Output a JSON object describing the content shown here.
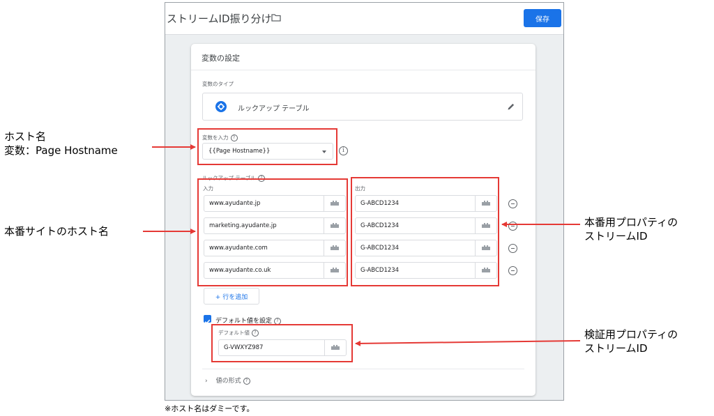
{
  "header": {
    "title": "ストリームID振り分け",
    "save_label": "保存"
  },
  "card": {
    "title": "変数の設定",
    "variable_type_label": "変数のタイプ",
    "variable_type_value": "ルックアップ テーブル",
    "input_variable_label": "変数を入力",
    "input_variable_value": "{{Page Hostname}}",
    "lookup_table_label": "ルックアップ テーブル",
    "input_column_label": "入力",
    "output_column_label": "出力",
    "rows": [
      {
        "input": "www.ayudante.jp",
        "output": "G-ABCD1234"
      },
      {
        "input": "marketing.ayudante.jp",
        "output": "G-ABCD1234"
      },
      {
        "input": "www.ayudante.com",
        "output": "G-ABCD1234"
      },
      {
        "input": "www.ayudante.co.uk",
        "output": "G-ABCD1234"
      }
    ],
    "add_row_label": "+ 行を追加",
    "default_checkbox_label": "デフォルト値を設定",
    "default_value_label": "デフォルト値",
    "default_value": "G-VWXYZ987",
    "value_format_label": "値の形式"
  },
  "annotations": {
    "host_name_line1": "ホスト名",
    "host_name_line2": "変数：Page Hostname",
    "production_hosts": "本番サイトのホスト名",
    "production_stream_line1": "本番用プロパティの",
    "production_stream_line2": "ストリームID",
    "test_stream_line1": "検証用プロパティの",
    "test_stream_line2": "ストリームID",
    "footnote": "※ホスト名はダミーです。"
  },
  "colors": {
    "accent": "#1a73e8",
    "annotation_red": "#e53935"
  },
  "icons": [
    "folder-icon",
    "gear-icon",
    "edit-icon",
    "chevron-down-icon",
    "info-icon",
    "help-icon",
    "variable-block-icon",
    "remove-row-icon",
    "checkbox-checked-icon",
    "chevron-right-icon"
  ]
}
